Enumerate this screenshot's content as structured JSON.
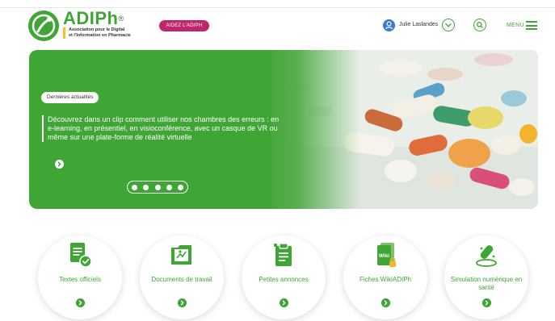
{
  "colors": {
    "brand_green": "#3fa535",
    "help_pink": "#c0266b",
    "user_blue": "#3a7bd5",
    "tagline_yellow": "#f0c419"
  },
  "header": {
    "brand": "ADIPh",
    "brand_mark": "®",
    "tagline_line1": "Association pour le Digital",
    "tagline_line2": "et l'Information en Pharmacie",
    "help_button": "AIDEZ L'ADIPH",
    "user_name": "Julie Laslandes",
    "menu_label": "MENU",
    "icons": {
      "logo": "adiph-logo-icon",
      "user": "user-icon",
      "user_menu": "chevron-down-icon",
      "search": "search-icon",
      "menu": "hamburger-icon"
    }
  },
  "hero": {
    "tag": "Dernières actualités",
    "headline": "Découvrez dans un clip comment utiliser nos chambres des erreurs : en e-learning, en présentiel, en visioconférence, avec un casque de VR ou même sur une plate-forme de réalité virtuelle",
    "carousel": {
      "slides": 5,
      "active": 1
    },
    "icons": {
      "more": "chevron-right-icon",
      "image": "pills-image"
    }
  },
  "tiles": [
    {
      "label": "Textes officiels",
      "icon": "document-check-icon"
    },
    {
      "label": "Documents de travail",
      "icon": "folder-icon"
    },
    {
      "label": "Petites annonces",
      "icon": "clipboard-icon"
    },
    {
      "label": "Fiches WikiADIPh",
      "icon": "wiki-icon",
      "icon_text": "Wiki"
    },
    {
      "label": "Simulation numérique en santé",
      "icon": "pill-simulation-icon"
    }
  ]
}
